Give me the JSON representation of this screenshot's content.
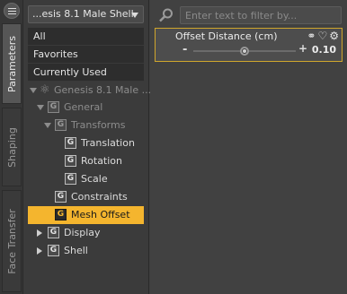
{
  "tabs": [
    {
      "label": "Parameters",
      "active": true
    },
    {
      "label": "Shaping",
      "active": false
    },
    {
      "label": "Face Transfer",
      "active": false
    }
  ],
  "node_selector": {
    "value": "...esis 8.1 Male Shell"
  },
  "categories": [
    {
      "label": "All"
    },
    {
      "label": "Favorites"
    },
    {
      "label": "Currently Used"
    }
  ],
  "tree": {
    "root": {
      "label": "Genesis 8.1 Male ..."
    },
    "general": {
      "label": "General"
    },
    "transforms": {
      "label": "Transforms"
    },
    "translation": {
      "label": "Translation"
    },
    "rotation": {
      "label": "Rotation"
    },
    "scale": {
      "label": "Scale"
    },
    "constraints": {
      "label": "Constraints"
    },
    "mesh_offset": {
      "label": "Mesh Offset",
      "selected": true
    },
    "display": {
      "label": "Display"
    },
    "shell": {
      "label": "Shell"
    }
  },
  "filter": {
    "placeholder": "Enter text to filter by..."
  },
  "property": {
    "label": "Offset Distance (cm)",
    "minus": "-",
    "plus": "+",
    "value": "0.10",
    "slider_fraction": 0.5
  },
  "colors": {
    "accent": "#f4b52e",
    "border_highlight": "#d0a62c"
  }
}
